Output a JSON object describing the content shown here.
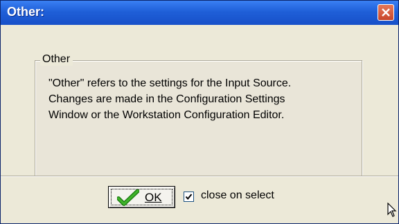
{
  "window": {
    "title": "Other:",
    "close_icon": "close-icon"
  },
  "group": {
    "legend": "Other",
    "lines": [
      "\"Other\" refers to the settings for the Input Source.",
      "Changes are made in the Configuration Settings",
      "Window or the Workstation Configuration Editor."
    ]
  },
  "footer": {
    "ok_label": "OK",
    "ok_icon": "checkmark-icon",
    "checkbox_checked": true,
    "checkbox_label": "close on select"
  },
  "colors": {
    "titlebar": "#1f5fd8",
    "close_button": "#c8462b",
    "dialog_bg": "#ece9d8",
    "ok_check": "#2e9a1e"
  }
}
